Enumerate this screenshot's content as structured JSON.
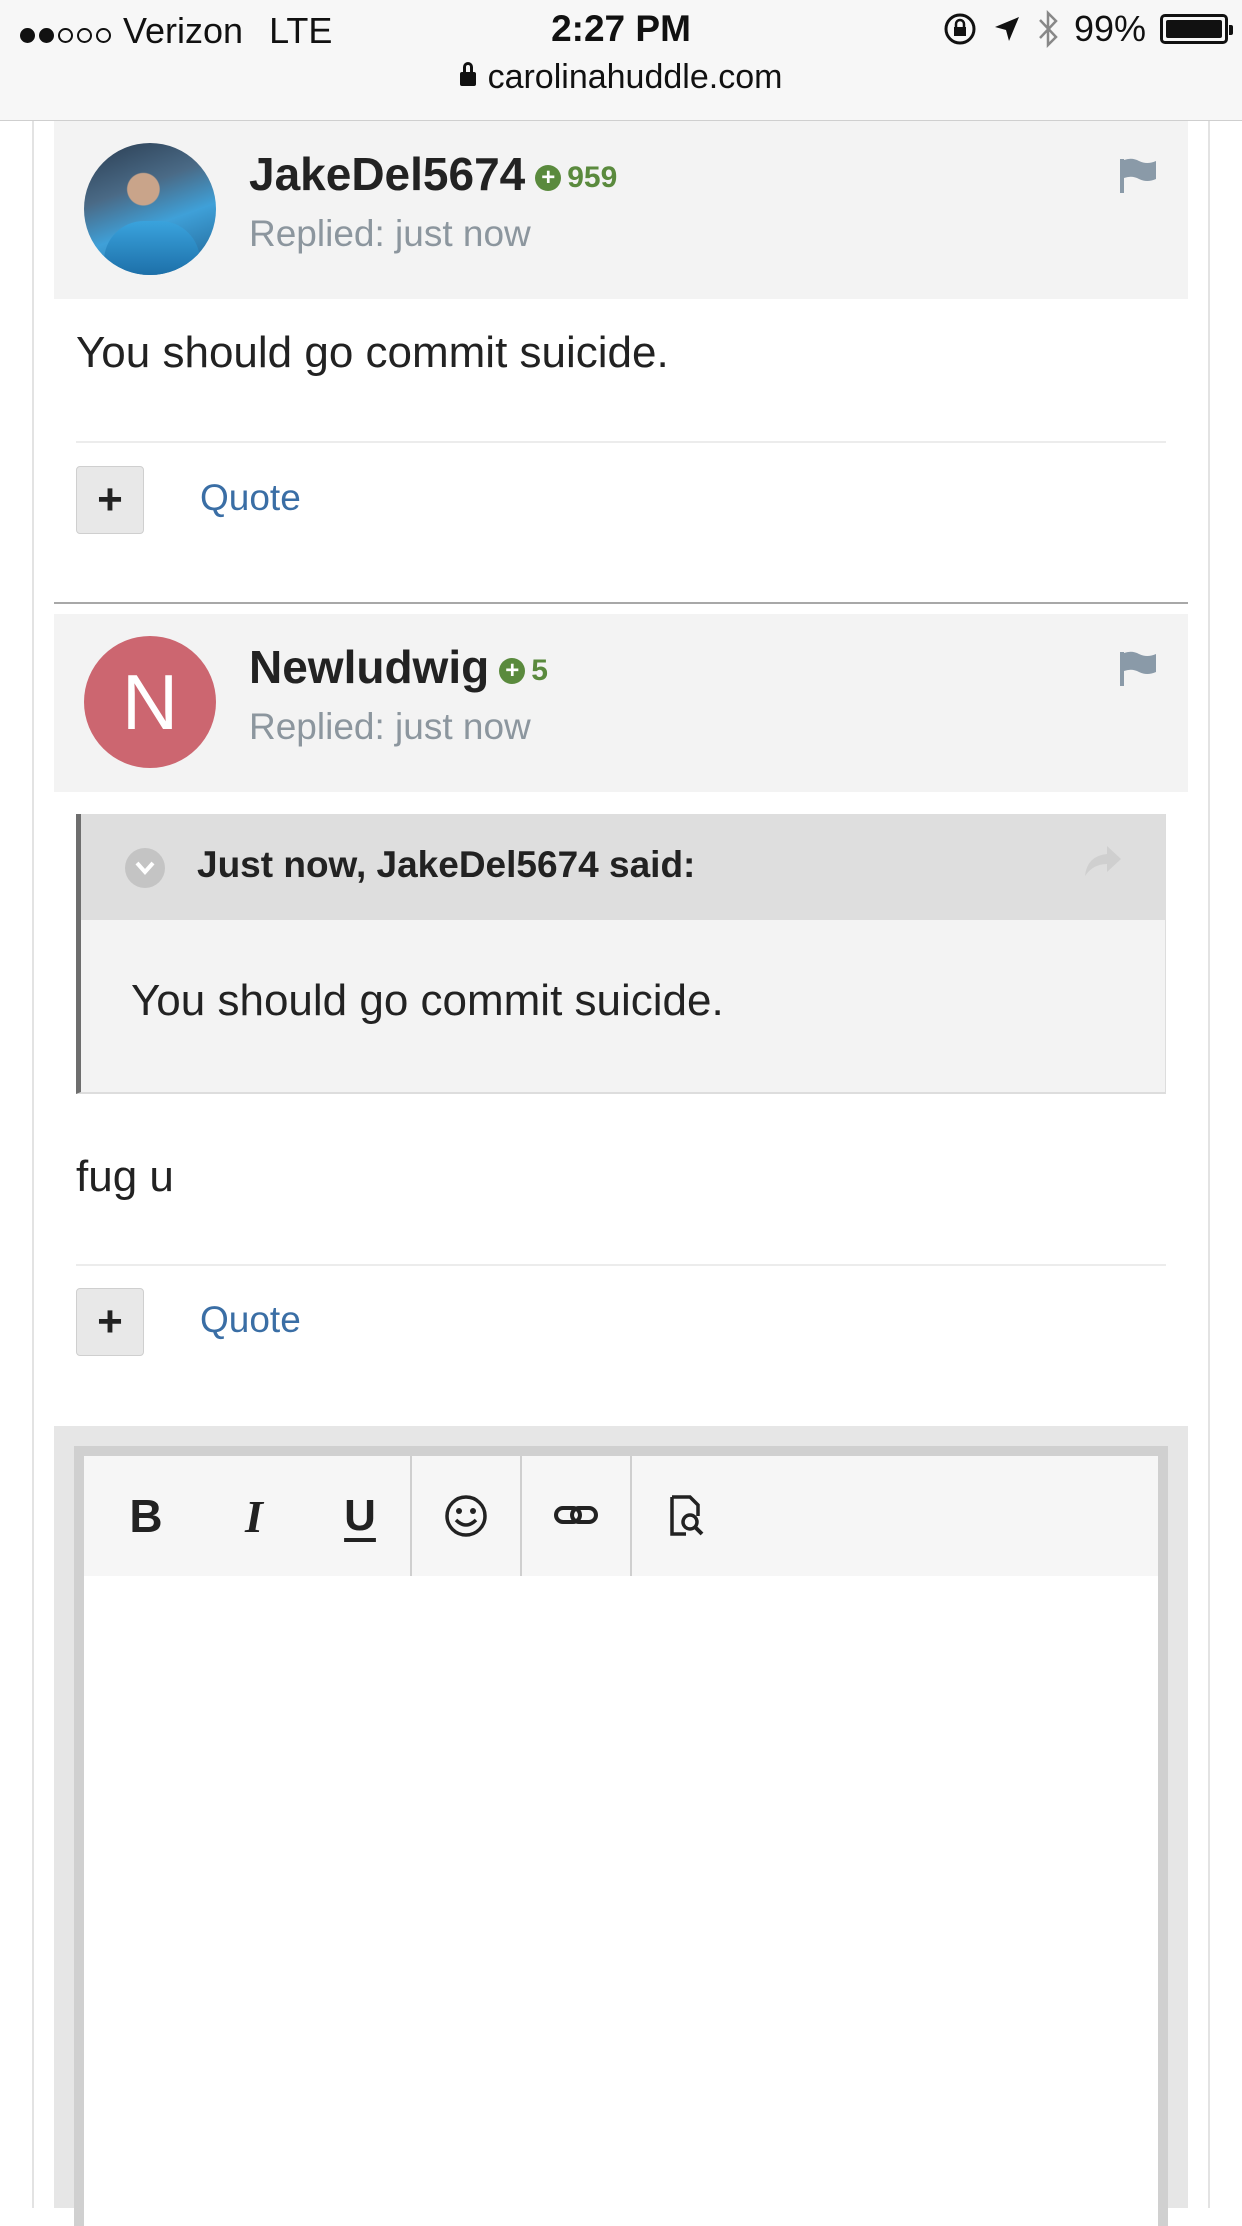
{
  "status": {
    "carrier": "Verizon",
    "network": "LTE",
    "time": "2:27 PM",
    "battery": "99%",
    "url": "carolinahuddle.com"
  },
  "posts": [
    {
      "username": "JakeDel5674",
      "reputation": "959",
      "replied": "Replied: just now",
      "body": "You should go commit suicide.",
      "quote_label": "Quote"
    },
    {
      "username": "Newludwig",
      "avatar_letter": "N",
      "reputation": "5",
      "replied": "Replied: just now",
      "quoted_cite": "Just now, JakeDel5674 said:",
      "quoted_text": "You should go commit suicide.",
      "body": "fug u",
      "quote_label": "Quote"
    }
  ],
  "editor": {
    "bold": "B",
    "italic": "I",
    "underline": "U"
  },
  "colors": {
    "reputation": "#5a8a3d",
    "link": "#3a6ea5",
    "avatar_letter_bg": "#cc6670"
  },
  "icons": [
    "signal-dots-icon",
    "lock-icon",
    "rotation-lock-icon",
    "location-arrow-icon",
    "bluetooth-icon",
    "battery-icon",
    "flag-icon",
    "plus-circle-icon",
    "chevron-down-icon",
    "share-icon",
    "emoji-icon",
    "link-icon",
    "preview-icon"
  ]
}
